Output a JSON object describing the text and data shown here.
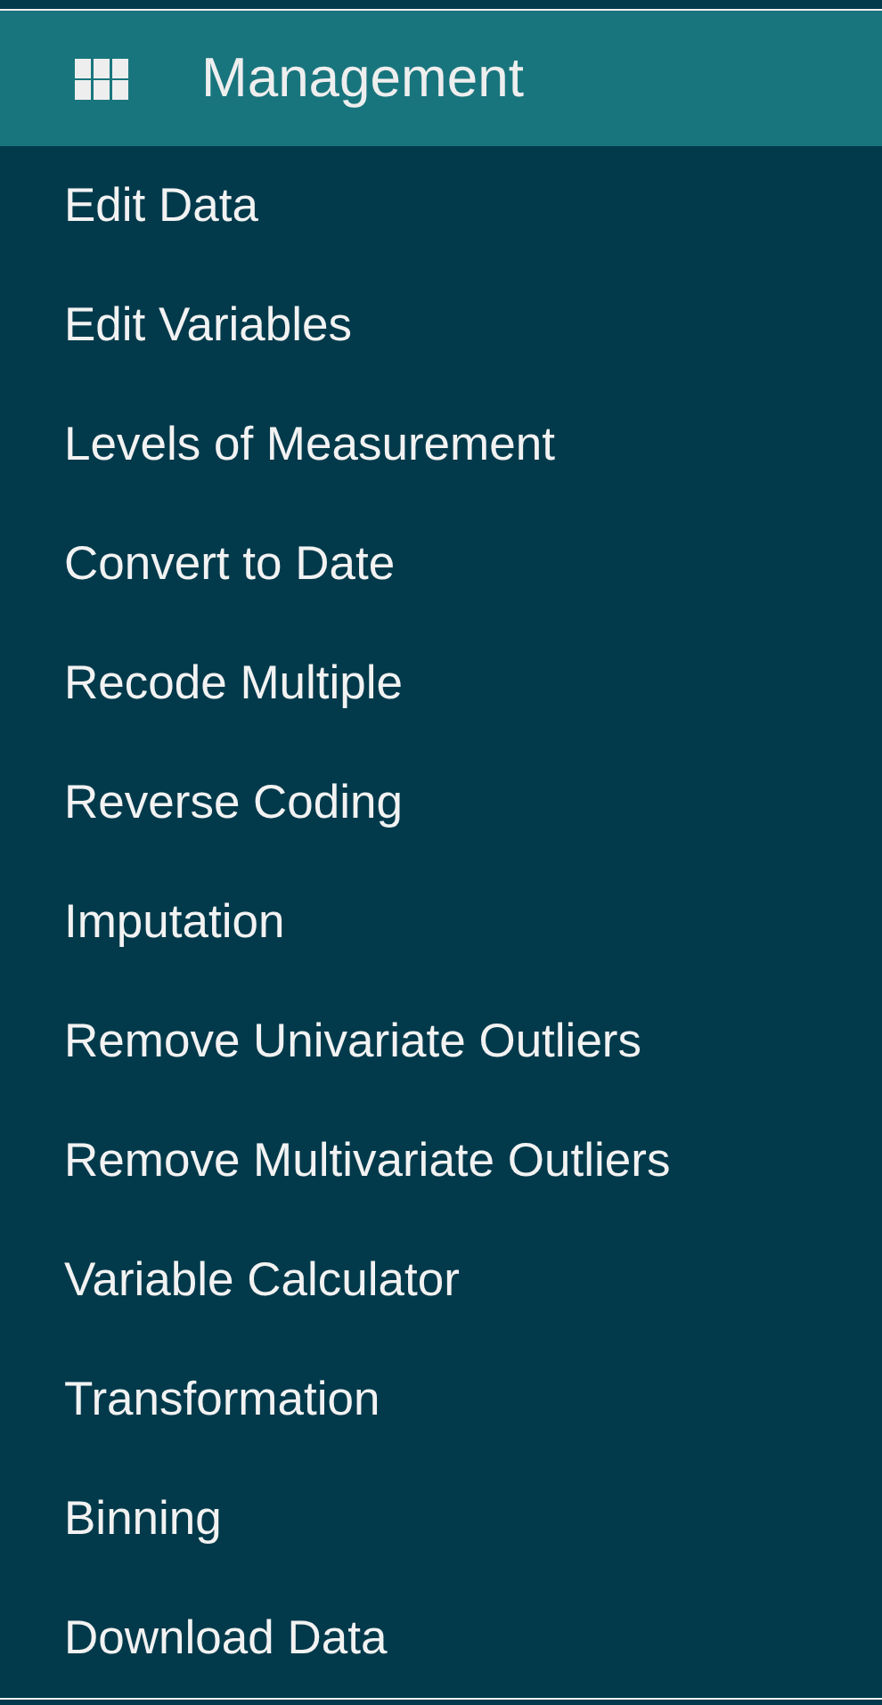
{
  "header": {
    "title": "Management"
  },
  "menu": [
    {
      "label": "Edit Data"
    },
    {
      "label": "Edit Variables"
    },
    {
      "label": "Levels of Measurement"
    },
    {
      "label": "Convert to Date"
    },
    {
      "label": "Recode Multiple"
    },
    {
      "label": "Reverse Coding"
    },
    {
      "label": "Imputation"
    },
    {
      "label": "Remove Univariate Outliers"
    },
    {
      "label": "Remove Multivariate Outliers"
    },
    {
      "label": "Variable Calculator"
    },
    {
      "label": "Transformation"
    },
    {
      "label": "Binning"
    },
    {
      "label": "Download Data"
    }
  ]
}
